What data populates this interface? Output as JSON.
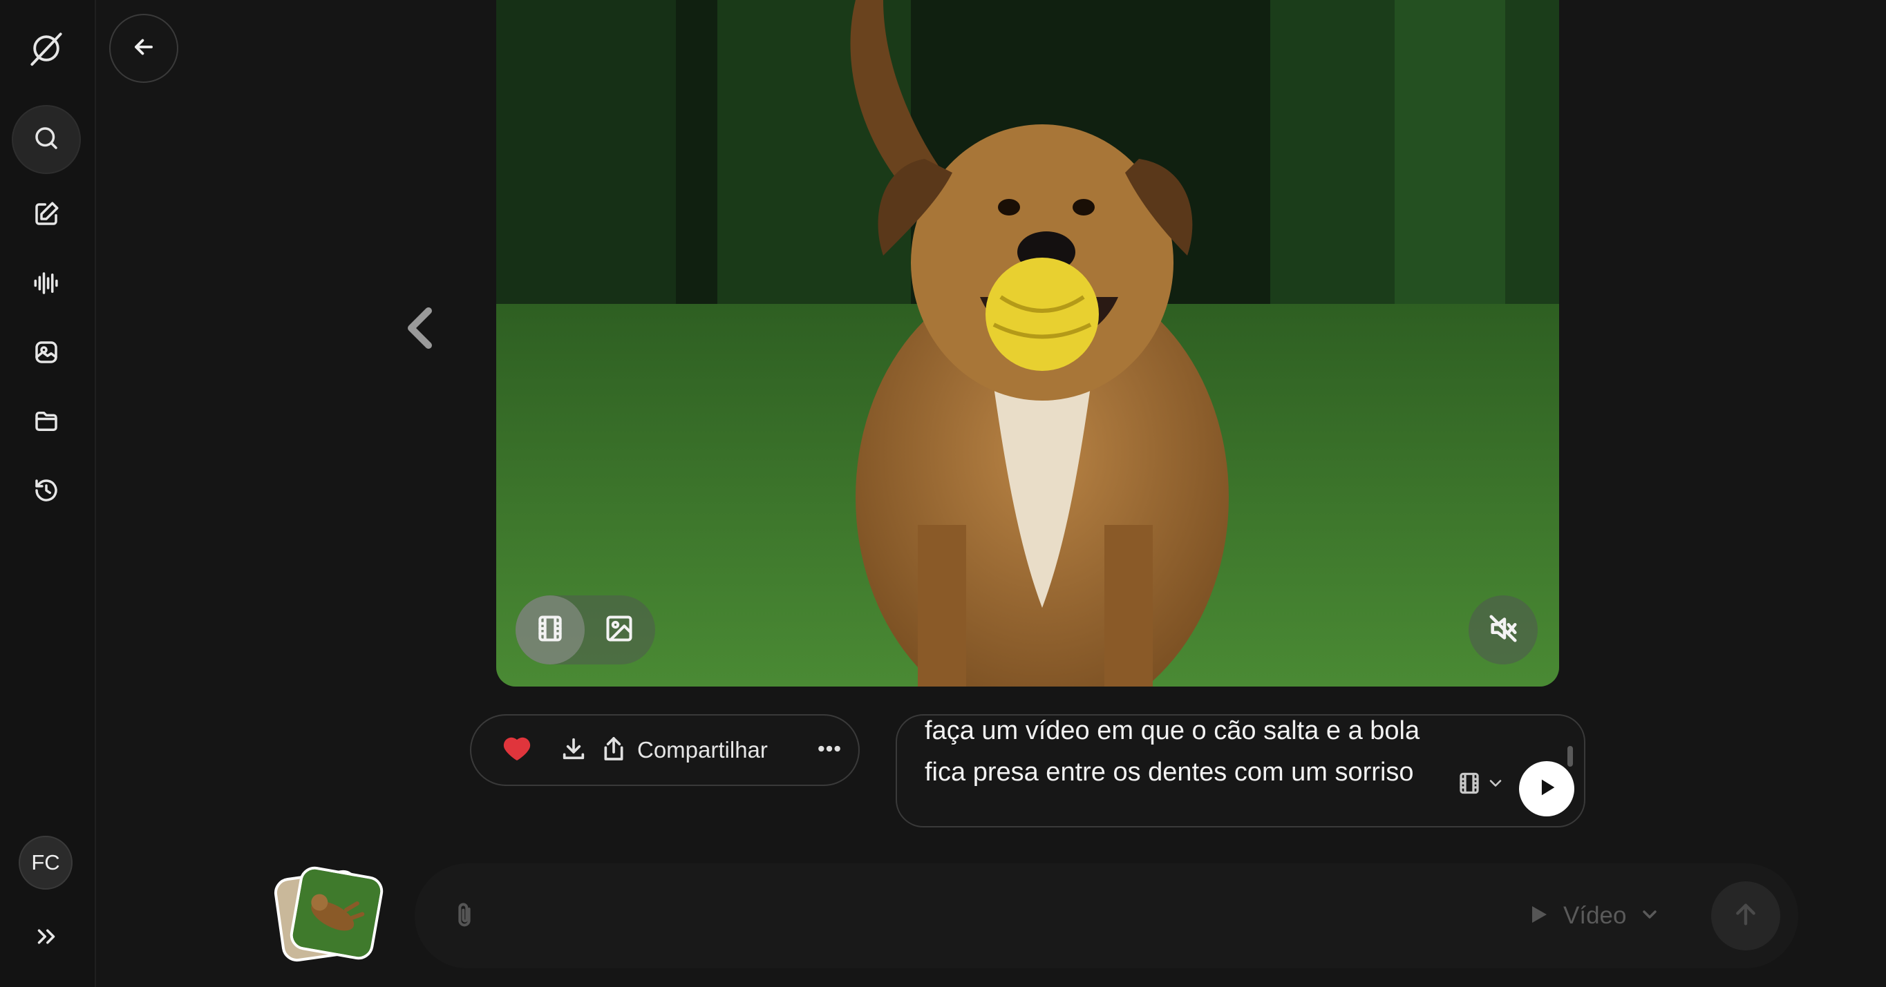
{
  "sidebar": {
    "items": [
      {
        "icon": "logo-icon"
      },
      {
        "icon": "search-icon"
      },
      {
        "icon": "edit-icon"
      },
      {
        "icon": "voice-icon"
      },
      {
        "icon": "media-icon"
      },
      {
        "icon": "folder-icon"
      },
      {
        "icon": "history-icon"
      }
    ],
    "avatar_initials": "FC",
    "expand_icon": "double-chevron-right-icon"
  },
  "viewer": {
    "mode_toggle": {
      "options": [
        "video",
        "image"
      ],
      "selected": "video"
    },
    "muted": true
  },
  "actions": {
    "share_label": "Compartilhar"
  },
  "prompt": {
    "text": "faça um vídeo em que o cão salta e a bola fica presa entre os dentes com um sorriso"
  },
  "composer": {
    "mode_label": "Vídeo"
  },
  "colors": {
    "background": "#151515",
    "heart": "#e0353c",
    "play_button": "#ffffff"
  }
}
